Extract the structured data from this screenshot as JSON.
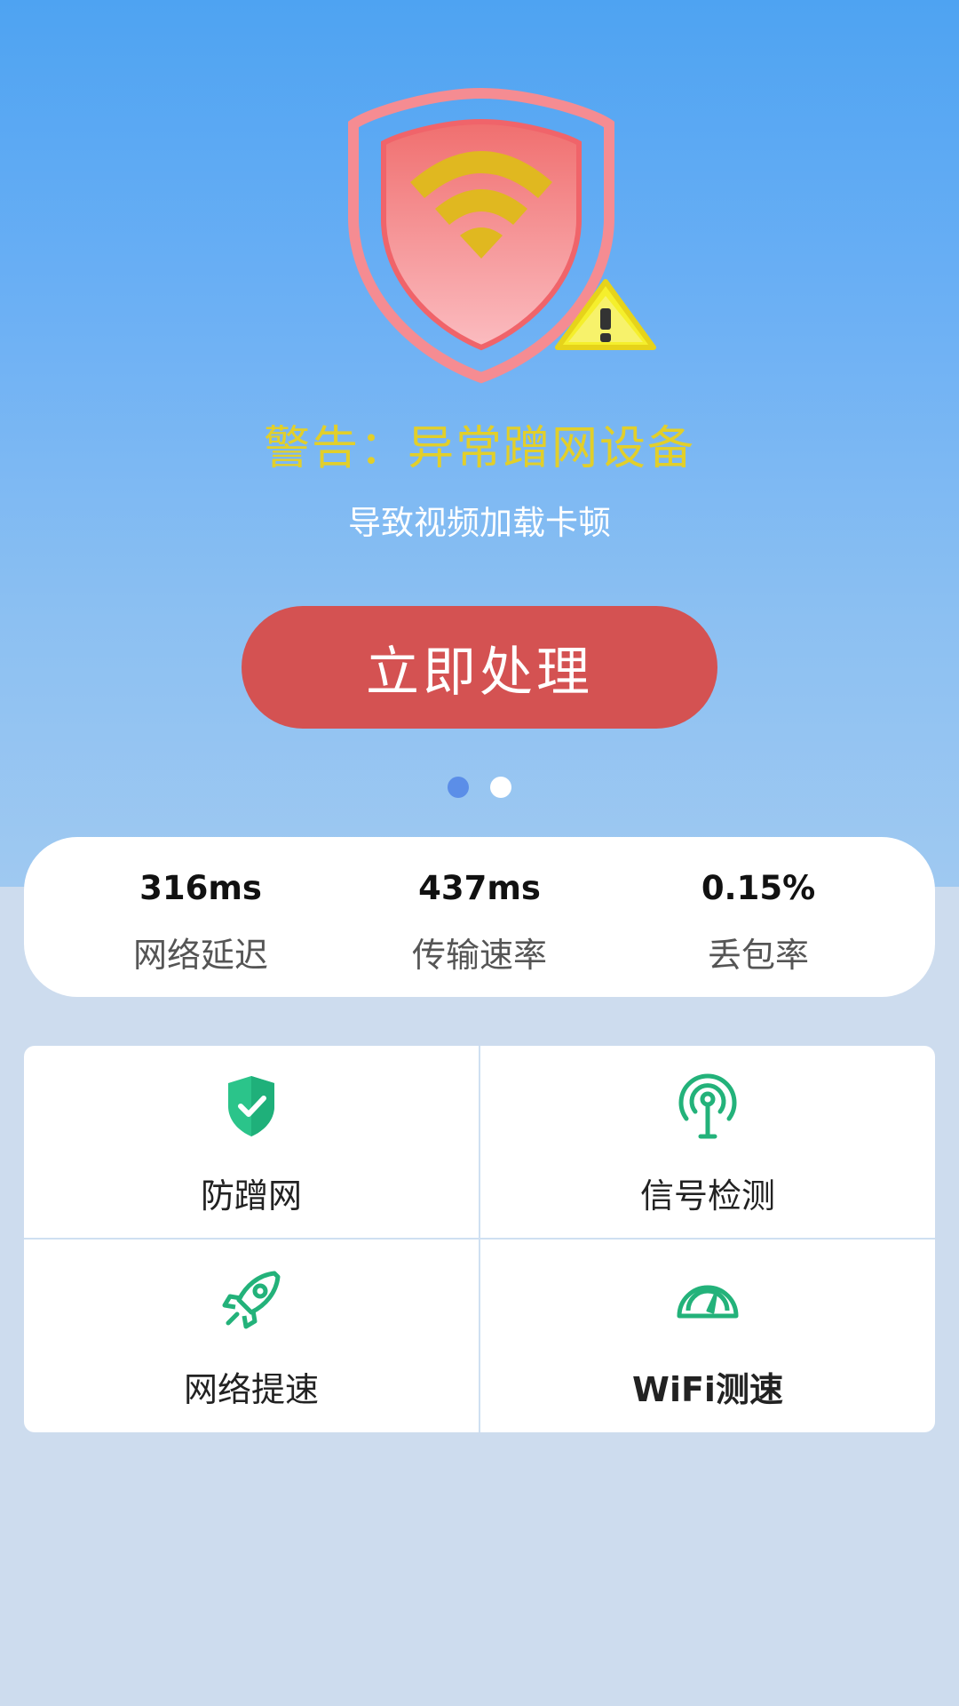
{
  "hero": {
    "warning_title": "警告：异常蹭网设备",
    "warning_subtitle": "导致视频加载卡顿",
    "action_button": "立即处理",
    "page_indicator": {
      "current": 1,
      "total": 2
    }
  },
  "stats": [
    {
      "value": "316ms",
      "label": "网络延迟"
    },
    {
      "value": "437ms",
      "label": "传输速率"
    },
    {
      "value": "0.15%",
      "label": "丢包率"
    }
  ],
  "features": [
    {
      "label": "防蹭网",
      "icon": "shield-check-icon"
    },
    {
      "label": "信号检测",
      "icon": "signal-tower-icon"
    },
    {
      "label": "网络提速",
      "icon": "rocket-icon"
    },
    {
      "label": "WiFi测速",
      "icon": "speedometer-icon"
    }
  ],
  "colors": {
    "hero_top": "#4ea3f2",
    "warning_text": "#e2cf2a",
    "action_button": "#d45252",
    "icon_green": "#23b27a",
    "page_background": "#cddcee"
  }
}
